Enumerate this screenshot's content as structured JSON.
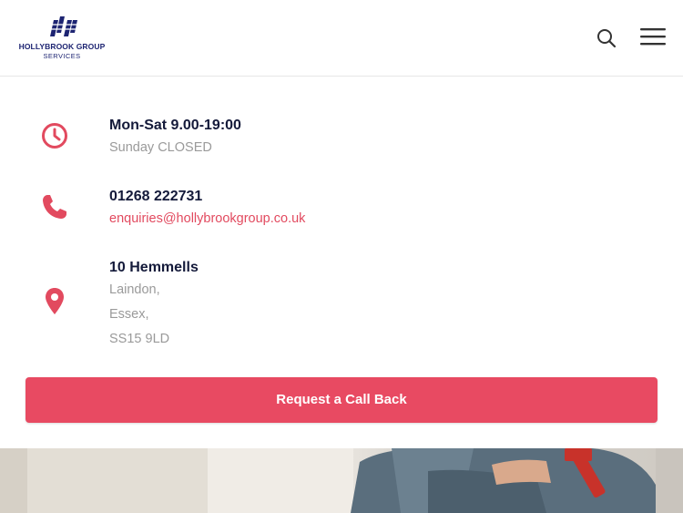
{
  "header": {
    "logo_name": "HOLLYBROOK GROUP",
    "logo_sub": "SERVICES",
    "search_icon": "search-icon",
    "menu_icon": "hamburger-menu-icon"
  },
  "contact": {
    "hours": {
      "icon": "clock-icon",
      "title": "Mon-Sat 9.00-19:00",
      "line": "Sunday CLOSED"
    },
    "phone": {
      "icon": "phone-icon",
      "title": "01268 222731",
      "email": "enquiries@hollybrookgroup.co.uk"
    },
    "address": {
      "icon": "map-pin-icon",
      "title": "10 Hemmells",
      "lines": [
        "Laindon,",
        "Essex,",
        "SS15 9LD"
      ]
    }
  },
  "cta": {
    "label": "Request a Call Back"
  },
  "colors": {
    "accent": "#e84a62",
    "brand_navy": "#1d2472",
    "heading": "#141a3a",
    "muted": "#9a9a9a"
  }
}
